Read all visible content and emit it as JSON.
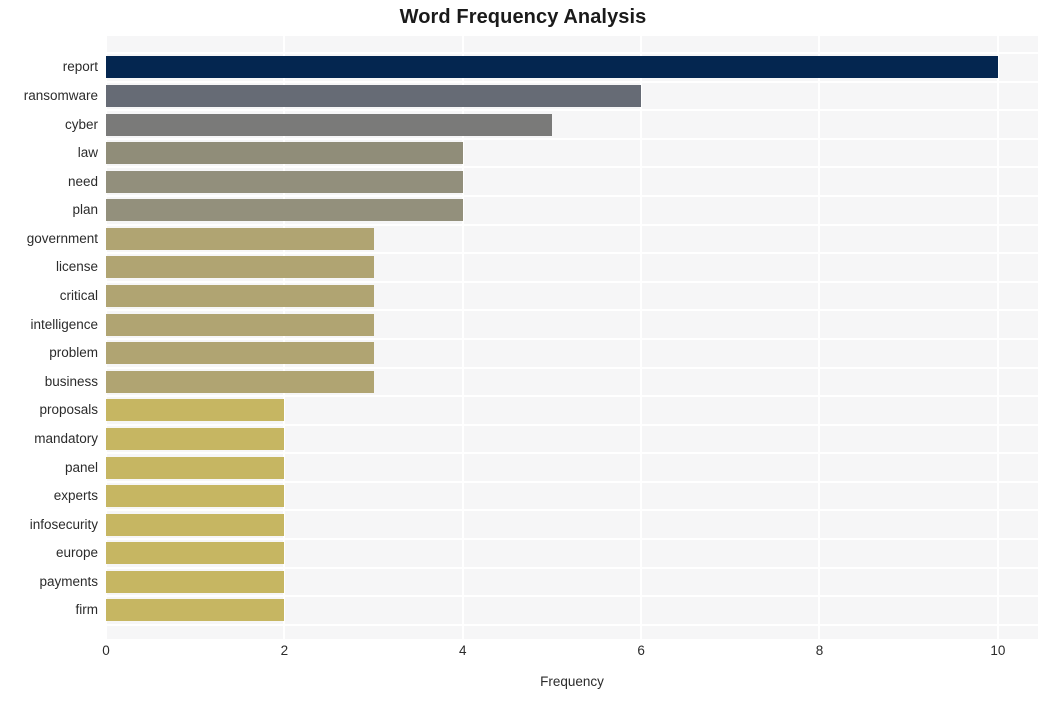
{
  "chart_data": {
    "type": "bar",
    "orientation": "horizontal",
    "title": "Word Frequency Analysis",
    "xlabel": "Frequency",
    "ylabel": "",
    "xlim": [
      0,
      10.45
    ],
    "xticks": [
      0,
      2,
      4,
      6,
      8,
      10
    ],
    "xtick_labels": [
      "0",
      "2",
      "4",
      "6",
      "8",
      "10"
    ],
    "grid": true,
    "legend": null,
    "plot_background": "#f6f6f7",
    "gridline_color": "#ffffff",
    "categories": [
      "report",
      "ransomware",
      "cyber",
      "law",
      "need",
      "plan",
      "government",
      "license",
      "critical",
      "intelligence",
      "problem",
      "business",
      "proposals",
      "mandatory",
      "panel",
      "experts",
      "infosecurity",
      "europe",
      "payments",
      "firm"
    ],
    "values": [
      10,
      6,
      5,
      4,
      4,
      4,
      3,
      3,
      3,
      3,
      3,
      3,
      2,
      2,
      2,
      2,
      2,
      2,
      2,
      2
    ],
    "bar_colors": [
      "#042650",
      "#666b75",
      "#7a7a79",
      "#908d79",
      "#928f7c",
      "#93907c",
      "#b0a472",
      "#b0a472",
      "#b0a472",
      "#b0a472",
      "#b0a472",
      "#b0a472",
      "#c6b662",
      "#c6b662",
      "#c6b662",
      "#c6b662",
      "#c6b662",
      "#c6b662",
      "#c6b662",
      "#c6b662"
    ]
  },
  "chart": {
    "title": "Word Frequency Analysis",
    "x_axis_title": "Frequency"
  }
}
